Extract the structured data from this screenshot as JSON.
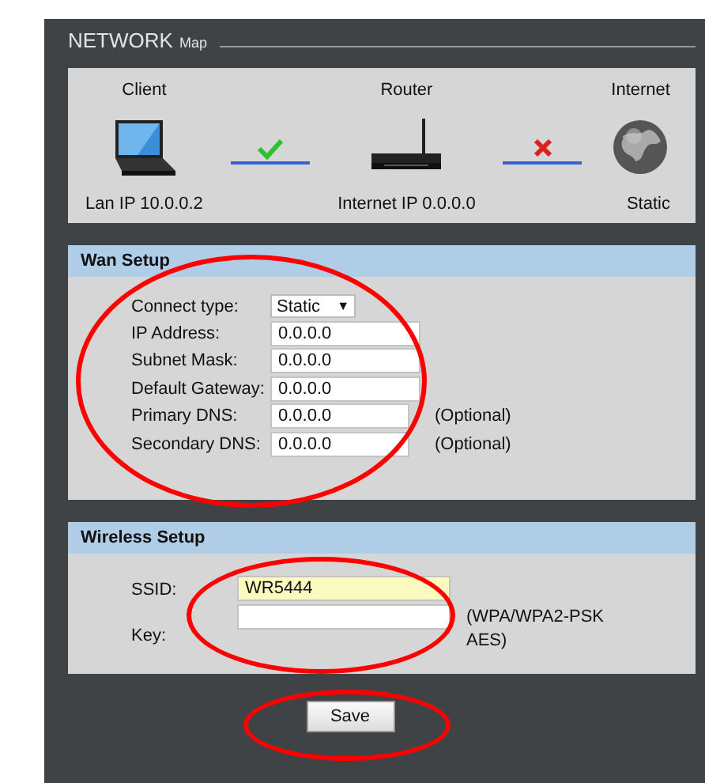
{
  "title": "NETWORK",
  "subtitle": "Map",
  "map": {
    "nodes": [
      {
        "kind": "laptop",
        "label": "Client",
        "caption": "Lan IP 10.0.0.2"
      },
      {
        "kind": "router",
        "label": "Router",
        "caption": "Internet IP 0.0.0.0"
      },
      {
        "kind": "globe",
        "label": "Internet",
        "caption": "Static"
      }
    ],
    "links": [
      {
        "connected": true
      },
      {
        "connected": false
      }
    ]
  },
  "sections": [
    {
      "title": "Wan Setup",
      "circled": true,
      "fields": [
        {
          "kind": "select",
          "label": "Connect type:",
          "value": "Static",
          "caret": "▼"
        },
        {
          "kind": "text",
          "label": "IP Address:",
          "value": "0.0.0.0"
        },
        {
          "kind": "text",
          "label": "Subnet Mask:",
          "value": "0.0.0.0"
        },
        {
          "kind": "text",
          "label": "Default Gateway:",
          "value": "0.0.0.0"
        },
        {
          "kind": "text",
          "label": "Primary DNS:",
          "value": "0.0.0.0",
          "note": "(Optional)"
        },
        {
          "kind": "text",
          "label": "Secondary DNS:",
          "value": "0.0.0.0",
          "note": "(Optional)"
        }
      ]
    },
    {
      "title": "Wireless Setup",
      "circled": true,
      "fields": [
        {
          "kind": "text",
          "label": "SSID:",
          "value": "WR5444",
          "highlighted": true
        },
        {
          "kind": "text",
          "label": "Key:",
          "highlighted": false,
          "note": "(WPA/WPA2-PSK AES)"
        }
      ]
    }
  ],
  "save": {
    "label": "Save",
    "circled": true
  }
}
